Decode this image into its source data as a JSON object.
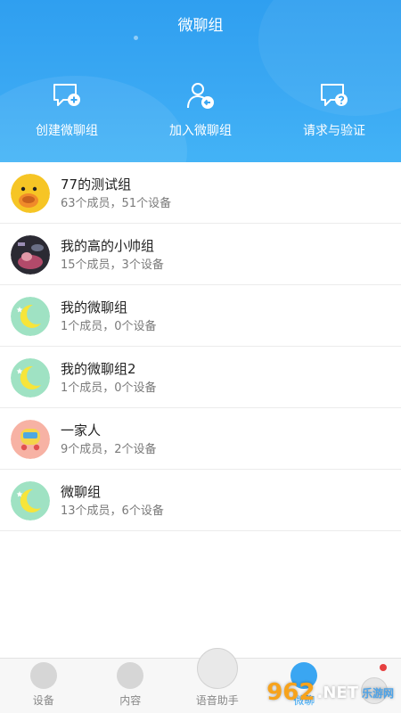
{
  "header": {
    "title": "微聊组",
    "actions": [
      {
        "label": "创建微聊组",
        "icon": "chat-add-icon"
      },
      {
        "label": "加入微聊组",
        "icon": "person-join-icon"
      },
      {
        "label": "请求与验证",
        "icon": "chat-question-icon"
      }
    ]
  },
  "groups": [
    {
      "name": "77的测试组",
      "meta": "63个成员，51个设备",
      "avatar": "duck-avatar"
    },
    {
      "name": "我的高的小帅组",
      "meta": "15个成员，3个设备",
      "avatar": "photo-avatar"
    },
    {
      "name": "我的微聊组",
      "meta": "1个成员，0个设备",
      "avatar": "moon-avatar"
    },
    {
      "name": "我的微聊组2",
      "meta": "1个成员，0个设备",
      "avatar": "moon-avatar"
    },
    {
      "name": "一家人",
      "meta": "9个成员，2个设备",
      "avatar": "bus-avatar"
    },
    {
      "name": "微聊组",
      "meta": "13个成员，6个设备",
      "avatar": "moon-avatar"
    }
  ],
  "nav": {
    "items": [
      {
        "label": "设备"
      },
      {
        "label": "内容"
      },
      {
        "label": "语音助手"
      },
      {
        "label": "微聊"
      }
    ],
    "active_index": 3
  },
  "watermark": {
    "brand": "962",
    "suffix": ".NET",
    "sub": "乐游网"
  },
  "colors": {
    "accent": "#3aa6f2",
    "header": "#2f9ff0"
  }
}
